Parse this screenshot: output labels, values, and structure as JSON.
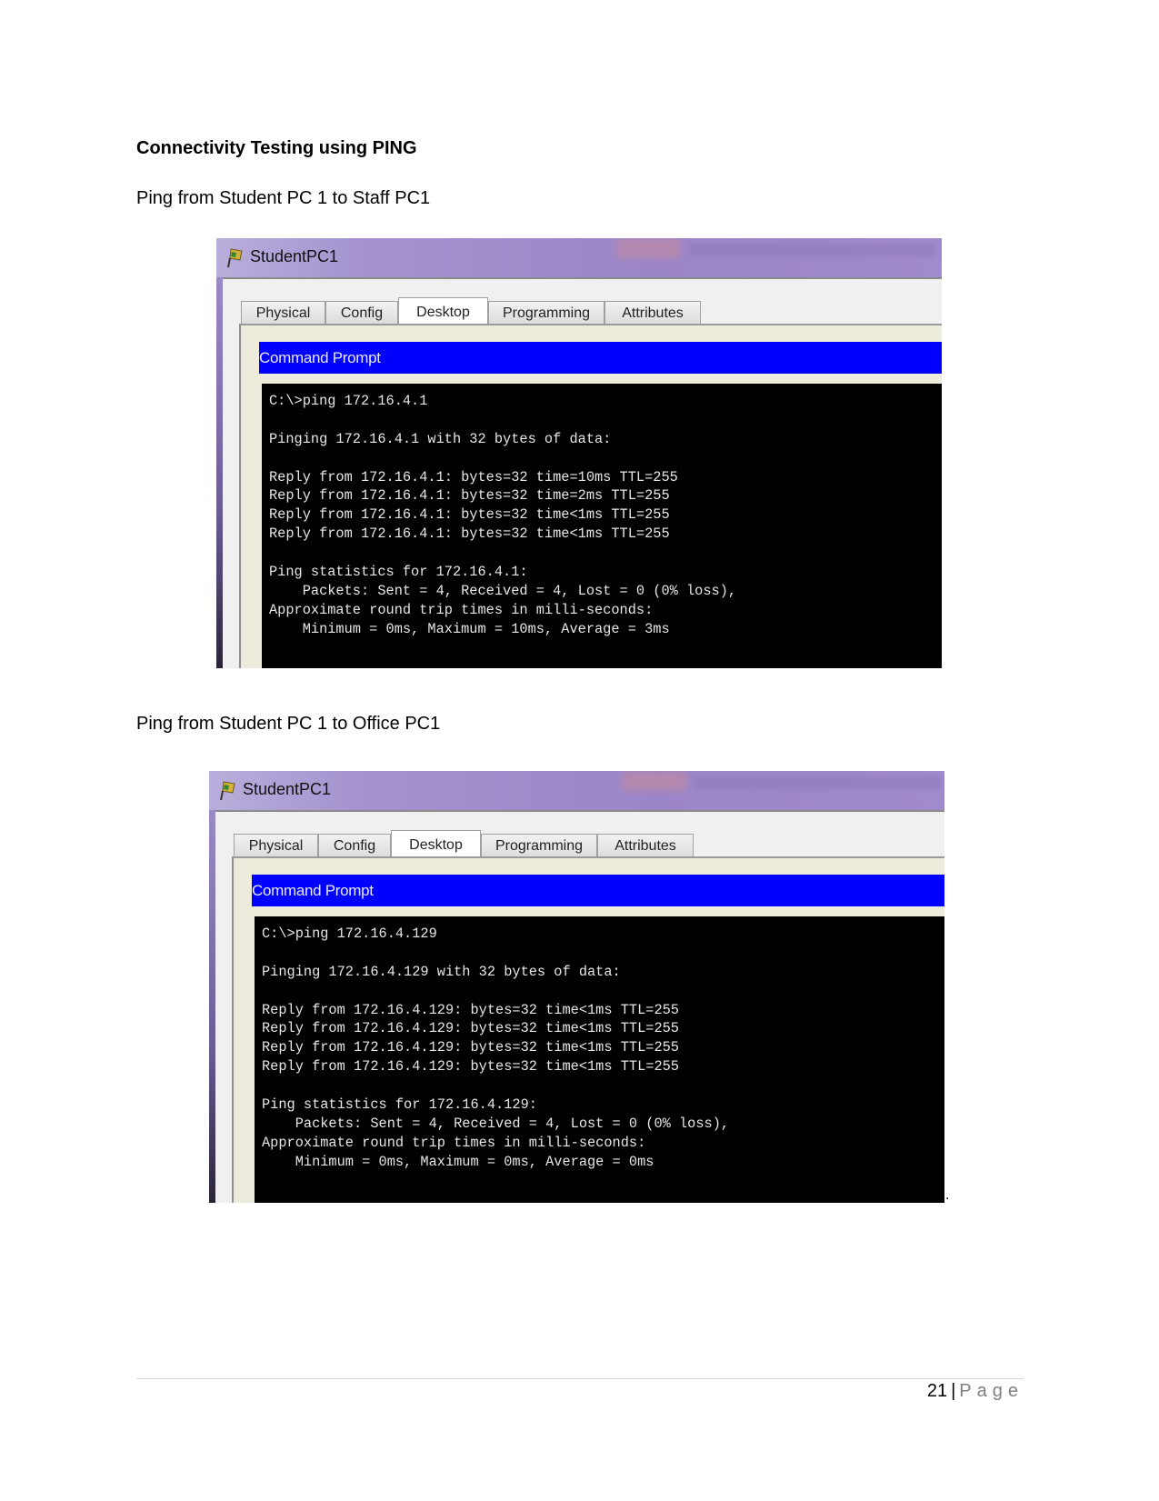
{
  "document": {
    "heading": "Connectivity Testing using PING",
    "sections": [
      {
        "caption": "Ping from Student PC 1 to Staff PC1",
        "window": {
          "title": "StudentPC1",
          "icon": "packet-tracer-pc-icon",
          "tabs": [
            {
              "label": "Physical",
              "active": false
            },
            {
              "label": "Config",
              "active": false
            },
            {
              "label": "Desktop",
              "active": true
            },
            {
              "label": "Programming",
              "active": false
            },
            {
              "label": "Attributes",
              "active": false
            }
          ],
          "app_bar": "Command Prompt",
          "terminal_lines": [
            "C:\\>ping 172.16.4.1",
            "",
            "Pinging 172.16.4.1 with 32 bytes of data:",
            "",
            "Reply from 172.16.4.1: bytes=32 time=10ms TTL=255",
            "Reply from 172.16.4.1: bytes=32 time=2ms TTL=255",
            "Reply from 172.16.4.1: bytes=32 time<1ms TTL=255",
            "Reply from 172.16.4.1: bytes=32 time<1ms TTL=255",
            "",
            "Ping statistics for 172.16.4.1:",
            "    Packets: Sent = 4, Received = 4, Lost = 0 (0% loss),",
            "Approximate round trip times in milli-seconds:",
            "    Minimum = 0ms, Maximum = 10ms, Average = 3ms"
          ]
        }
      },
      {
        "caption": "Ping from Student PC 1 to Office PC1",
        "window": {
          "title": "StudentPC1",
          "icon": "packet-tracer-pc-icon",
          "tabs": [
            {
              "label": "Physical",
              "active": false
            },
            {
              "label": "Config",
              "active": false
            },
            {
              "label": "Desktop",
              "active": true
            },
            {
              "label": "Programming",
              "active": false
            },
            {
              "label": "Attributes",
              "active": false
            }
          ],
          "app_bar": "Command Prompt",
          "terminal_lines": [
            "C:\\>ping 172.16.4.129",
            "",
            "Pinging 172.16.4.129 with 32 bytes of data:",
            "",
            "Reply from 172.16.4.129: bytes=32 time<1ms TTL=255",
            "Reply from 172.16.4.129: bytes=32 time<1ms TTL=255",
            "Reply from 172.16.4.129: bytes=32 time<1ms TTL=255",
            "Reply from 172.16.4.129: bytes=32 time<1ms TTL=255",
            "",
            "Ping statistics for 172.16.4.129:",
            "    Packets: Sent = 4, Received = 4, Lost = 0 (0% loss),",
            "Approximate round trip times in milli-seconds:",
            "    Minimum = 0ms, Maximum = 0ms, Average = 0ms"
          ]
        }
      }
    ],
    "trailing_mark": "."
  },
  "footer": {
    "page_number": "21",
    "separator": "|",
    "page_label": "Page"
  },
  "colors": {
    "app_bar": "#0000ff",
    "terminal_bg": "#000000",
    "terminal_fg": "#e6e6e6",
    "titlebar": "#9b86c8"
  }
}
